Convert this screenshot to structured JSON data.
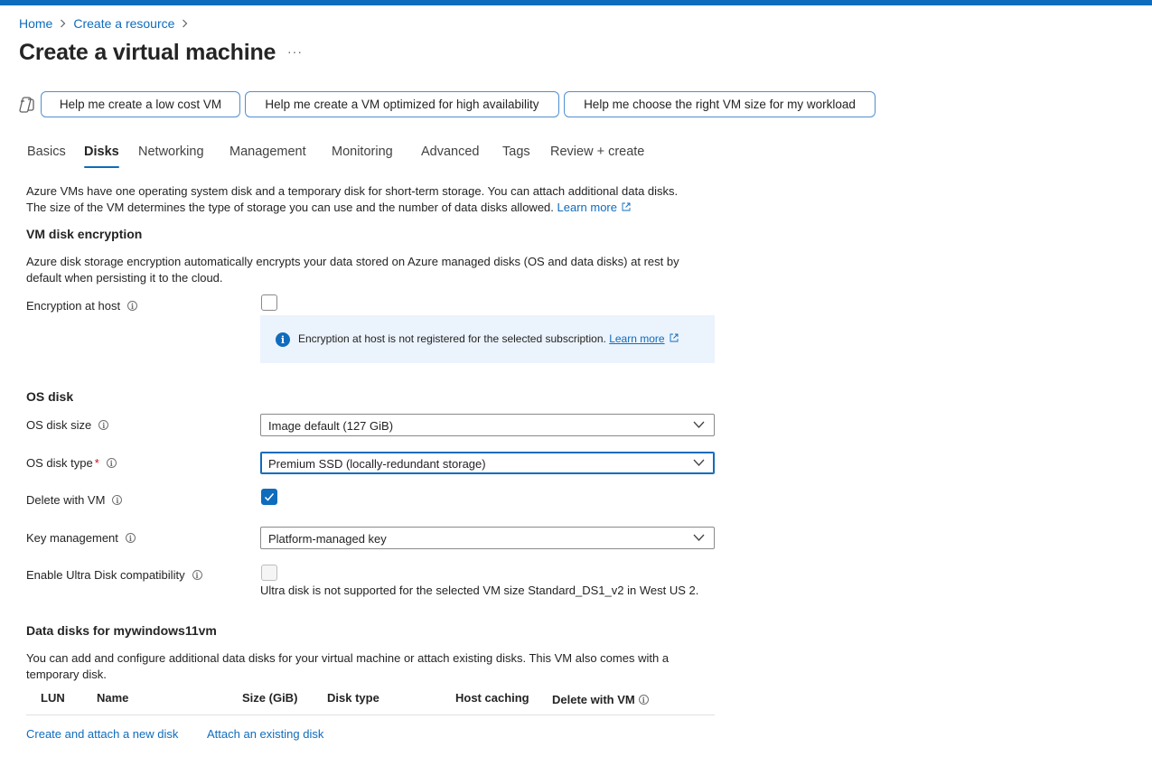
{
  "breadcrumb": {
    "home": "Home",
    "create_resource": "Create a resource"
  },
  "page": {
    "title": "Create a virtual machine",
    "more": "···"
  },
  "copilot": {
    "prompt1": "Help me create a low cost VM",
    "prompt2": "Help me create a VM optimized for high availability",
    "prompt3": "Help me choose the right VM size for my workload"
  },
  "tabs": {
    "basics": "Basics",
    "disks": "Disks",
    "networking": "Networking",
    "management": "Management",
    "monitoring": "Monitoring",
    "advanced": "Advanced",
    "tags": "Tags",
    "review": "Review + create"
  },
  "intro": {
    "line1": "Azure VMs have one operating system disk and a temporary disk for short-term storage. You can attach additional data disks.",
    "line2": "The size of the VM determines the type of storage you can use and the number of data disks allowed.",
    "learn_more": "Learn more"
  },
  "encryption": {
    "heading": "VM disk encryption",
    "description": "Azure disk storage encryption automatically encrypts your data stored on Azure managed disks (OS and data disks) at rest by default when persisting it to the cloud.",
    "host_label": "Encryption at host",
    "host_checked": false,
    "info_text": "Encryption at host is not registered for the selected subscription.",
    "info_link": "Learn more"
  },
  "os_disk": {
    "heading": "OS disk",
    "size_label": "OS disk size",
    "size_value": "Image default (127 GiB)",
    "type_label": "OS disk type",
    "type_required": "*",
    "type_value": "Premium SSD (locally-redundant storage)",
    "delete_label": "Delete with VM",
    "delete_checked": true,
    "key_label": "Key management",
    "key_value": "Platform-managed key",
    "ultra_label": "Enable Ultra Disk compatibility",
    "ultra_checked": false,
    "ultra_note": "Ultra disk is not supported for the selected VM size Standard_DS1_v2 in West US 2."
  },
  "data_disks": {
    "heading": "Data disks for mywindows11vm",
    "description": "You can add and configure additional data disks for your virtual machine or attach existing disks. This VM also comes with a temporary disk.",
    "columns": {
      "lun": "LUN",
      "name": "Name",
      "size": "Size (GiB)",
      "disk_type": "Disk type",
      "host_caching": "Host caching",
      "delete_with_vm": "Delete with VM"
    },
    "create_link": "Create and attach a new disk",
    "attach_link": "Attach an existing disk"
  },
  "colors": {
    "accent": "#0f6cbd",
    "info_bg": "#ebf3fc",
    "required": "#c50f1f"
  }
}
